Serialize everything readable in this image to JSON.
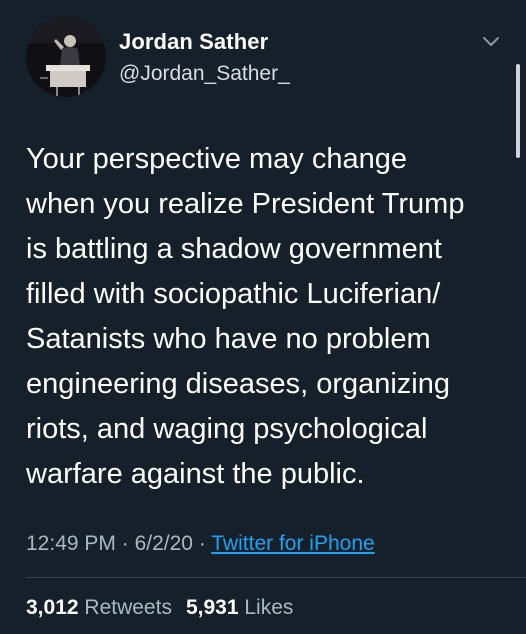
{
  "tweet": {
    "author": {
      "name": "Jordan Sather",
      "handle": "@Jordan_Sather_"
    },
    "text_lines": [
      "Your perspective may change",
      "when you realize President Trump",
      "is battling a shadow government",
      "filled with sociopathic Luciferian/",
      "Satanists who have no problem",
      "engineering diseases, organizing",
      "riots, and waging psychological",
      "warfare against the public."
    ],
    "time": "12:49 PM",
    "date": "6/2/20",
    "separator": "·",
    "source": "Twitter for iPhone",
    "retweets": "3,012",
    "retweets_label": "Retweets",
    "likes": "5,931",
    "likes_label": "Likes"
  },
  "icons": {
    "menu": "chevron-down-icon",
    "avatar": "profile-photo"
  },
  "colors": {
    "background": "#15202b",
    "link": "#1da1f2",
    "secondary_text": "#aab8c2",
    "divider": "#38444d"
  }
}
